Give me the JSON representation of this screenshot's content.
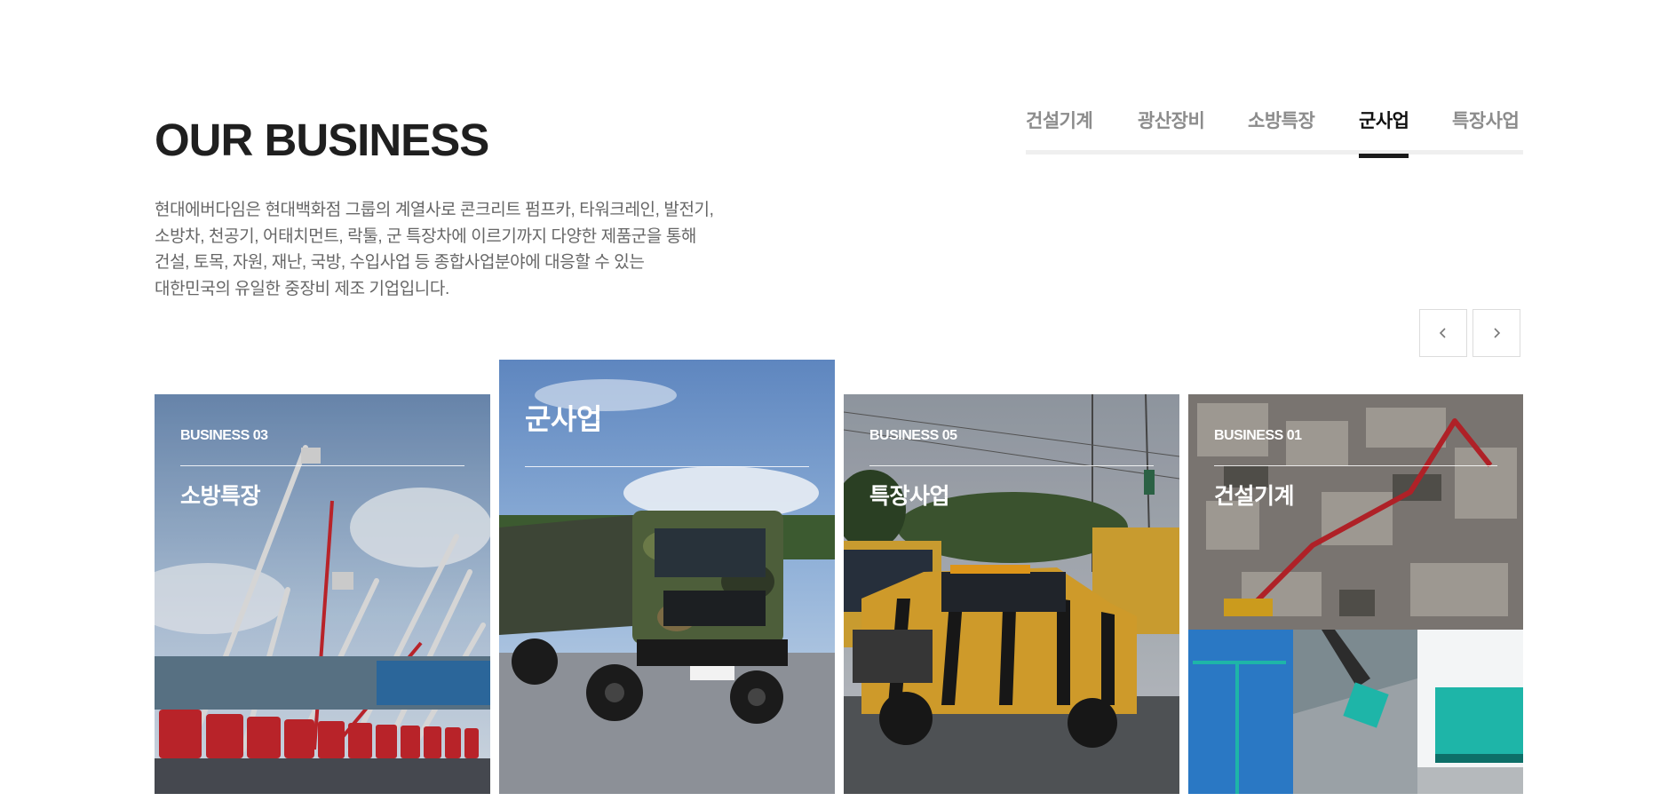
{
  "section": {
    "title": "OUR BUSINESS",
    "description_lines": [
      "현대에버다임은 현대백화점 그룹의 계열사로 콘크리트 펌프카, 타워크레인, 발전기,",
      "소방차, 천공기, 어태치먼트, 락툴, 군 특장차에 이르기까지 다양한 제품군을 통해",
      "건설, 토목, 자원, 재난, 국방, 수입사업 등 종합사업분야에 대응할 수 있는",
      "대한민국의 유일한 중장비 제조 기업입니다."
    ]
  },
  "tabs": [
    {
      "label": "건설기계",
      "active": false
    },
    {
      "label": "광산장비",
      "active": false
    },
    {
      "label": "소방특장",
      "active": false
    },
    {
      "label": "군사업",
      "active": true
    },
    {
      "label": "특장사업",
      "active": false
    }
  ],
  "nav": {
    "prev_icon": "chevron-left-icon",
    "next_icon": "chevron-right-icon"
  },
  "cards": [
    {
      "label": "BUSINESS 03",
      "name": "소방특장",
      "image": "fire-truck-ladders-photo"
    },
    {
      "label": "",
      "name": "군사업",
      "image": "military-truck-photo",
      "active": true
    },
    {
      "label": "BUSINESS 05",
      "name": "특장사업",
      "image": "tiger-striped-pickup-photo"
    },
    {
      "label": "BUSINESS 01",
      "name": "건설기계",
      "image": "construction-machinery-collage"
    }
  ],
  "colors": {
    "text_dark": "#1f1f1f",
    "text_gray": "#666666",
    "tab_inactive": "#8c8c8c",
    "tab_track": "#efefef",
    "tab_active_bar": "#1a1a1a",
    "military_green": "#4d5e3a",
    "tiger_yellow": "#e0a82e",
    "fire_red": "#c8262d",
    "teal_equipment": "#1eb5a8"
  }
}
